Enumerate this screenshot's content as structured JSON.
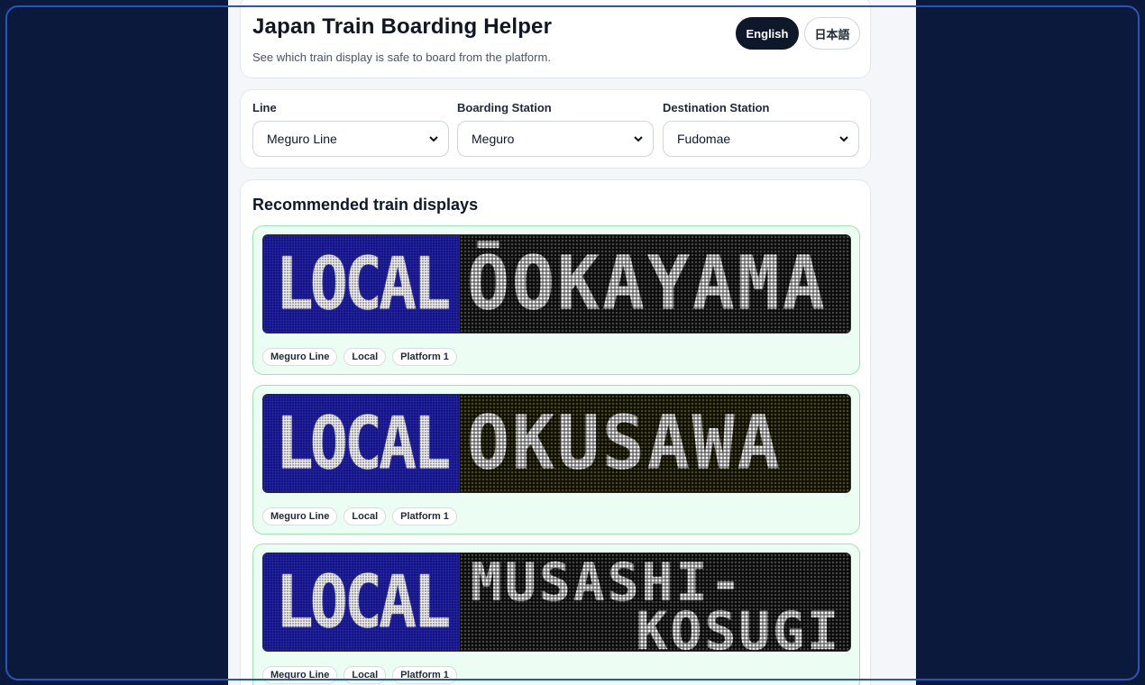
{
  "header": {
    "title": "Japan Train Boarding Helper",
    "subtitle": "See which train display is safe to board from the platform.",
    "lang_buttons": [
      {
        "label": "English",
        "active": true
      },
      {
        "label": "日本語",
        "active": false
      }
    ]
  },
  "filters": {
    "line": {
      "label": "Line",
      "value": "Meguro Line"
    },
    "boarding": {
      "label": "Boarding Station",
      "value": "Meguro"
    },
    "destination": {
      "label": "Destination Station",
      "value": "Fudomae"
    }
  },
  "results": {
    "title": "Recommended train displays",
    "items": [
      {
        "type": "LOCAL",
        "destination": "ŌOKAYAMA",
        "dest_line1": "",
        "dest_line2": "",
        "chips": [
          "Meguro Line",
          "Local",
          "Platform 1"
        ]
      },
      {
        "type": "LOCAL",
        "destination": "OKUSAWA",
        "dest_line1": "",
        "dest_line2": "",
        "chips": [
          "Meguro Line",
          "Local",
          "Platform 1"
        ]
      },
      {
        "type": "LOCAL",
        "destination": "",
        "dest_line1": "MUSASHI-",
        "dest_line2": "KOSUGI",
        "chips": [
          "Meguro Line",
          "Local",
          "Platform 1"
        ]
      }
    ]
  },
  "colors": {
    "type_panel": "#1818c4",
    "dest_panel": "#151515",
    "card_success_bg": "#ecfdf3",
    "card_success_border": "#9fe3b4",
    "active_lang": "#0f172a"
  }
}
